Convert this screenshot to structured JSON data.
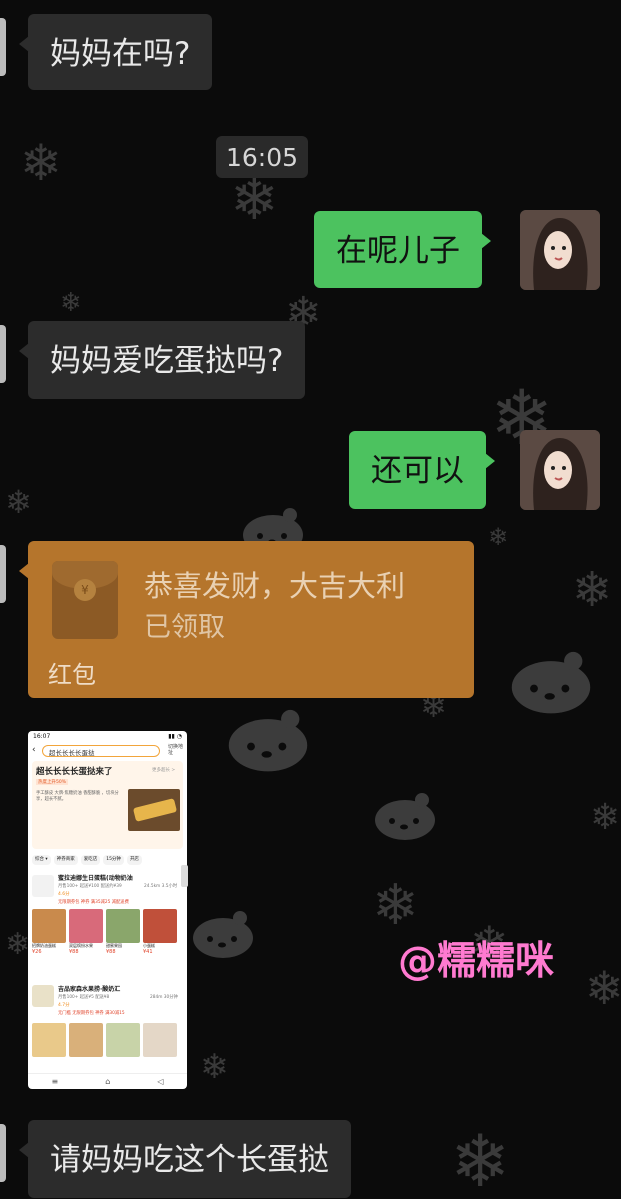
{
  "messages": {
    "m1": "妈妈在吗?",
    "time": "16:05",
    "m2": "在呢儿子",
    "m3": "妈妈爱吃蛋挞吗?",
    "m4": "还可以",
    "m5": "请妈妈吃这个长蛋挞"
  },
  "red_packet": {
    "title": "恭喜发财，大吉大利",
    "status": "已领取",
    "label": "红包"
  },
  "screenshot": {
    "status_time": "16:07",
    "search_text": "超长长长长蛋挞",
    "search_action": "切换地址",
    "promo_title": "超长长长长蛋挞来了",
    "promo_more": "更多超长 >",
    "promo_badge": "热度上升50%",
    "promo_desc": "手工酥皮 大牌·焦糖奶油 香甜酥脆 ，切块分享，超长不腻。",
    "filters": [
      "综合 ▾",
      "神券商家",
      "爱吃店",
      "15分钟",
      "开店"
    ],
    "store1_name": "蜜拉迪娜生日蛋糕(动物奶油",
    "store1_info": "月售100+  起送¥100  配送约¥39",
    "store1_rating": "4.6分",
    "store1_dist": "24.5km 3.5小时",
    "store1_tags": "无限期券包  神券 满35减25  减配送费",
    "store1_items": [
      {
        "name": "招牌奶油蛋糕",
        "price": "¥26"
      },
      {
        "name": "双层缤纷水果",
        "price": "¥88"
      },
      {
        "name": "甜蜜果园",
        "price": "¥88"
      },
      {
        "name": "小蛋糕",
        "price": "¥41"
      }
    ],
    "store2_name": "吉品家森水果捞·酸奶汇",
    "store2_info": "月售100+  起送¥5  配送¥8",
    "store2_rating": "4.7分",
    "store2_dist": "284m 30分钟",
    "store2_tags": "无门槛  无限期券包  神券 满30减15",
    "nav": [
      "≡",
      "⌂",
      "◁"
    ]
  },
  "watermark": "@糯糯咪",
  "colors": {
    "background": "#0b0b0b",
    "sent_bubble": "#4cc25f",
    "received_bubble": "#2c2c2c",
    "red_packet": "#b5752c",
    "watermark": "#ff7ad0"
  }
}
